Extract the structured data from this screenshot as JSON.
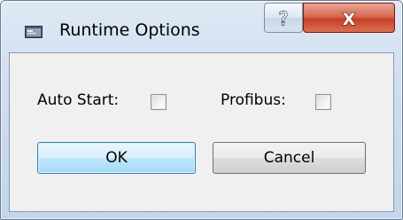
{
  "window": {
    "title": "Runtime Options",
    "icons": {
      "app": "app-window-icon",
      "help": "help-icon",
      "close": "close-icon"
    },
    "help_glyph": "?",
    "close_glyph": "X"
  },
  "options": {
    "auto_start_label": "Auto Start:",
    "auto_start_checked": false,
    "profibus_label": "Profibus:",
    "profibus_checked": false
  },
  "buttons": {
    "ok_label": "OK",
    "cancel_label": "Cancel"
  },
  "colors": {
    "close_button": "#c5412a",
    "default_button_border": "#3c7fb1"
  }
}
